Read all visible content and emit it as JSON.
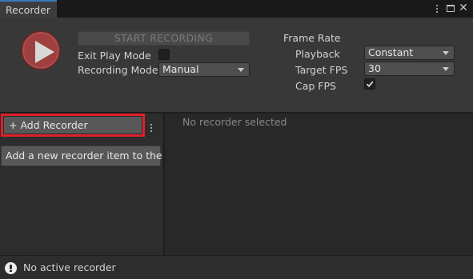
{
  "window": {
    "tab_title": "Recorder"
  },
  "controls": {
    "start_label": "START RECORDING",
    "exit_play_mode_label": "Exit Play Mode",
    "exit_play_mode_checked": false,
    "recording_mode_label": "Recording Mode",
    "recording_mode_value": "Manual"
  },
  "frame_rate": {
    "heading": "Frame Rate",
    "playback_label": "Playback",
    "playback_value": "Constant",
    "target_fps_label": "Target FPS",
    "target_fps_value": "30",
    "cap_fps_label": "Cap FPS",
    "cap_fps_checked": true
  },
  "recorders": {
    "add_label": "+ Add Recorder",
    "tooltip": "Add a new recorder item to the list",
    "empty_message": "No recorder selected"
  },
  "status": {
    "text": "No active recorder"
  },
  "colors": {
    "accent_tab": "#3a79bb",
    "record_button": "#9e4040",
    "highlight_box": "#e0202a"
  },
  "icons": {
    "play": "play-icon",
    "menu": "kebab-menu-icon",
    "maximize": "maximize-icon",
    "close": "close-icon",
    "info": "info-icon",
    "check": "checkmark-icon"
  }
}
